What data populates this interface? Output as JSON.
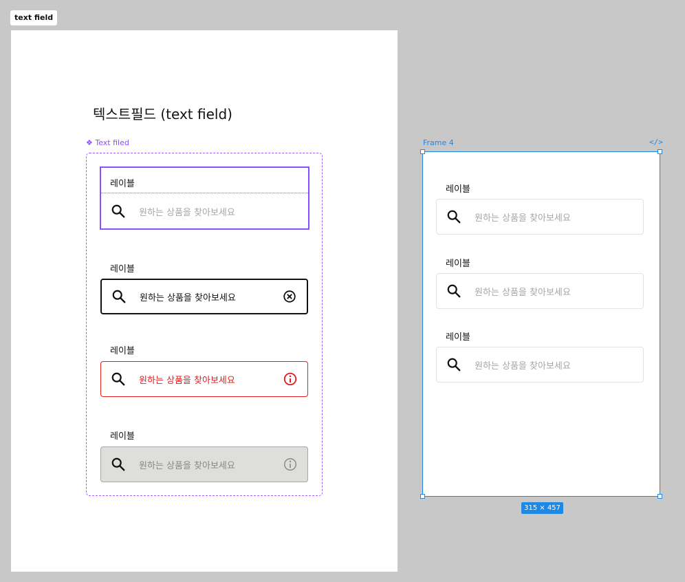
{
  "frame_tag": "text field",
  "artboard": {
    "title": "텍스트필드 (text field)",
    "component_label": "❖ Text filed",
    "variants": [
      {
        "label": "레이블",
        "placeholder": "원하는 상품을 찾아보세요",
        "state": "default-selected"
      },
      {
        "label": "레이블",
        "value": "원하는 상품을 찾아보세요",
        "state": "focus",
        "trailing_icon": "clear-circle-icon"
      },
      {
        "label": "레이블",
        "value": "원하는 상품을 찾아보세요",
        "state": "error",
        "trailing_icon": "info-circle-icon"
      },
      {
        "label": "레이블",
        "placeholder": "원하는 상품을 찾아보세요",
        "state": "disabled",
        "trailing_icon": "info-circle-icon"
      }
    ]
  },
  "frame4": {
    "name": "Frame 4",
    "code_icon": "</>",
    "size_badge": "315 × 457",
    "fields": [
      {
        "label": "레이블",
        "placeholder": "원하는 상품을 찾아보세요"
      },
      {
        "label": "레이블",
        "placeholder": "원하는 상품을 찾아보세요"
      },
      {
        "label": "레이블",
        "placeholder": "원하는 상품을 찾아보세요"
      }
    ]
  },
  "colors": {
    "canvas": "#c8c8c8",
    "component_purple": "#8b4dff",
    "selection_blue": "#1e88e5",
    "error_red": "#e51c1c",
    "disabled_fill": "#dededb",
    "placeholder_gray": "#a6a6a6"
  }
}
